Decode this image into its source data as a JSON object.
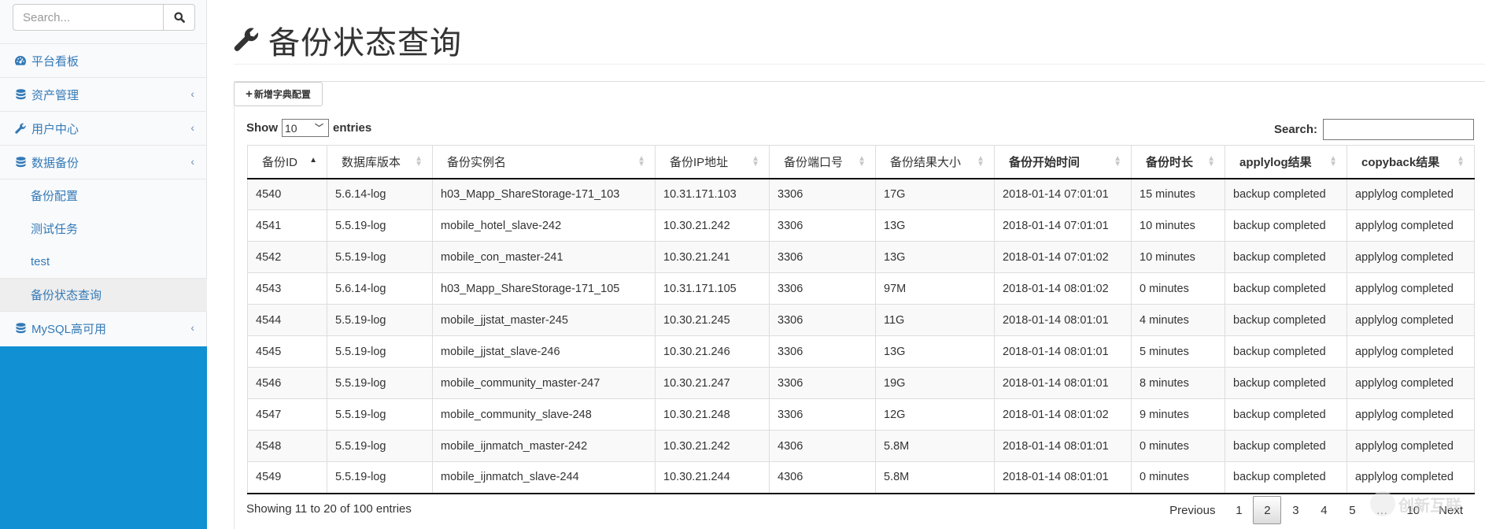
{
  "sidebar": {
    "search_placeholder": "Search...",
    "menu": [
      {
        "label": "平台看板",
        "icon": "dashboard-icon",
        "has_chevron": false
      },
      {
        "label": "资产管理",
        "icon": "database-icon",
        "has_chevron": true
      },
      {
        "label": "用户中心",
        "icon": "wrench-icon",
        "has_chevron": true
      },
      {
        "label": "数据备份",
        "icon": "database-icon",
        "has_chevron": true,
        "expanded": true,
        "children": [
          {
            "label": "备份配置",
            "active": false
          },
          {
            "label": "测试任务",
            "active": false
          },
          {
            "label": "test",
            "active": false
          },
          {
            "label": "备份状态查询",
            "active": true
          }
        ]
      },
      {
        "label": "MySQL高可用",
        "icon": "database-icon",
        "has_chevron": true
      }
    ],
    "chevron_glyph": "‹",
    "accent_color": "#1190d3"
  },
  "page": {
    "title": "备份状态查询",
    "title_icon": "wrench-icon",
    "add_button_label": "新增字典配置",
    "length": {
      "show_label": "Show",
      "value": "10",
      "entries_label": "entries"
    },
    "search_label": "Search:",
    "search_value": ""
  },
  "table": {
    "columns": [
      {
        "label": "备份ID",
        "sort": "asc",
        "bold": false
      },
      {
        "label": "数据库版本",
        "sort": "both",
        "bold": false
      },
      {
        "label": "备份实例名",
        "sort": "both",
        "bold": false
      },
      {
        "label": "备份IP地址",
        "sort": "both",
        "bold": false
      },
      {
        "label": "备份端口号",
        "sort": "both",
        "bold": false
      },
      {
        "label": "备份结果大小",
        "sort": "both",
        "bold": false
      },
      {
        "label": "备份开始时间",
        "sort": "both",
        "bold": true
      },
      {
        "label": "备份时长",
        "sort": "both",
        "bold": true
      },
      {
        "label": "applylog结果",
        "sort": "both",
        "bold": true
      },
      {
        "label": "copyback结果",
        "sort": "both",
        "bold": true
      }
    ],
    "rows": [
      [
        "4540",
        "5.6.14-log",
        "h03_Mapp_ShareStorage-171_103",
        "10.31.171.103",
        "3306",
        "17G",
        "2018-01-14 07:01:01",
        "15 minutes",
        "backup completed",
        "applylog completed"
      ],
      [
        "4541",
        "5.5.19-log",
        "mobile_hotel_slave-242",
        "10.30.21.242",
        "3306",
        "13G",
        "2018-01-14 07:01:01",
        "10 minutes",
        "backup completed",
        "applylog completed"
      ],
      [
        "4542",
        "5.5.19-log",
        "mobile_con_master-241",
        "10.30.21.241",
        "3306",
        "13G",
        "2018-01-14 07:01:02",
        "10 minutes",
        "backup completed",
        "applylog completed"
      ],
      [
        "4543",
        "5.6.14-log",
        "h03_Mapp_ShareStorage-171_105",
        "10.31.171.105",
        "3306",
        "97M",
        "2018-01-14 08:01:02",
        "0 minutes",
        "backup completed",
        "applylog completed"
      ],
      [
        "4544",
        "5.5.19-log",
        "mobile_jjstat_master-245",
        "10.30.21.245",
        "3306",
        "11G",
        "2018-01-14 08:01:01",
        "4 minutes",
        "backup completed",
        "applylog completed"
      ],
      [
        "4545",
        "5.5.19-log",
        "mobile_jjstat_slave-246",
        "10.30.21.246",
        "3306",
        "13G",
        "2018-01-14 08:01:01",
        "5 minutes",
        "backup completed",
        "applylog completed"
      ],
      [
        "4546",
        "5.5.19-log",
        "mobile_community_master-247",
        "10.30.21.247",
        "3306",
        "19G",
        "2018-01-14 08:01:01",
        "8 minutes",
        "backup completed",
        "applylog completed"
      ],
      [
        "4547",
        "5.5.19-log",
        "mobile_community_slave-248",
        "10.30.21.248",
        "3306",
        "12G",
        "2018-01-14 08:01:02",
        "9 minutes",
        "backup completed",
        "applylog completed"
      ],
      [
        "4548",
        "5.5.19-log",
        "mobile_ijnmatch_master-242",
        "10.30.21.242",
        "4306",
        "5.8M",
        "2018-01-14 08:01:01",
        "0 minutes",
        "backup completed",
        "applylog completed"
      ],
      [
        "4549",
        "5.5.19-log",
        "mobile_ijnmatch_slave-244",
        "10.30.21.244",
        "4306",
        "5.8M",
        "2018-01-14 08:01:01",
        "0 minutes",
        "backup completed",
        "applylog completed"
      ]
    ]
  },
  "footer": {
    "info": "Showing 11 to 20 of 100 entries",
    "pagination": {
      "previous": "Previous",
      "pages": [
        "1",
        "2",
        "3",
        "4",
        "5",
        "…",
        "10"
      ],
      "current": "2",
      "next": "Next"
    }
  },
  "watermark": {
    "text": "创新互联"
  }
}
